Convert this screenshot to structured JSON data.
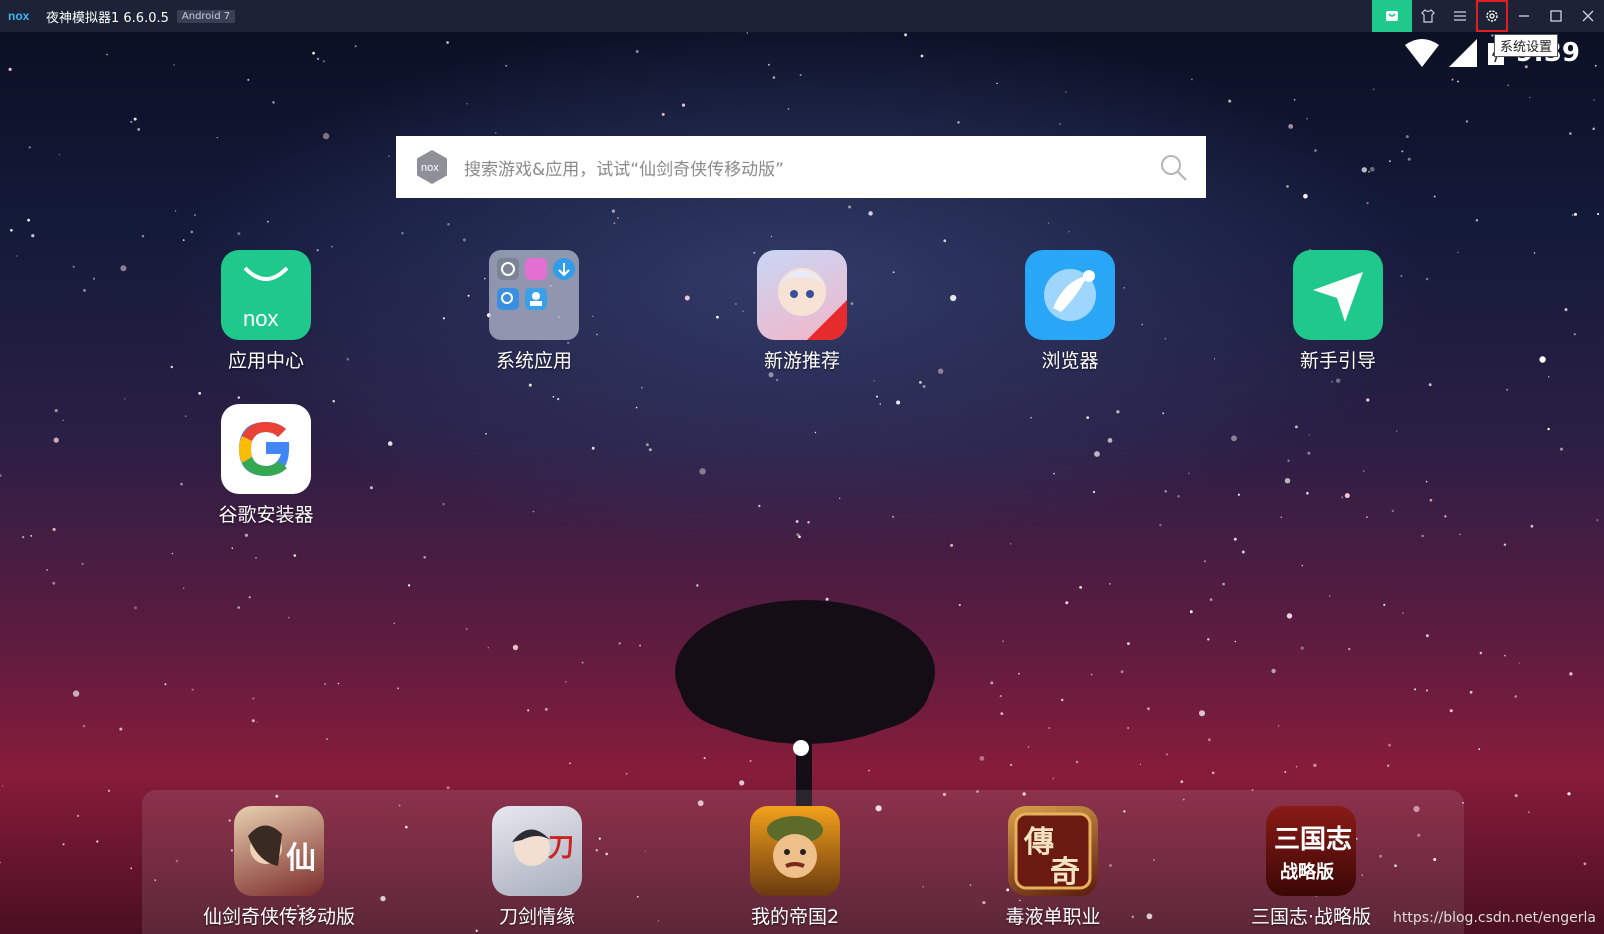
{
  "titlebar": {
    "logo": "nox",
    "title": "夜神模拟器1 6.6.0.5",
    "android_badge": "Android 7",
    "buttons": [
      "store-icon",
      "skin-icon",
      "menu-icon",
      "settings-icon",
      "minimize-icon",
      "maximize-icon",
      "close-icon"
    ],
    "tooltip": "系统设置",
    "accent": "#1ec98b"
  },
  "status": {
    "time": "9:39"
  },
  "search": {
    "placeholder": "搜索游戏&应用，试试“仙剑奇侠传移动版”"
  },
  "apps": [
    {
      "label": "应用中心",
      "icon": "nox-app-center-icon"
    },
    {
      "label": "系统应用",
      "icon": "system-apps-folder-icon"
    },
    {
      "label": "新游推荐",
      "icon": "new-games-icon"
    },
    {
      "label": "浏览器",
      "icon": "browser-icon"
    },
    {
      "label": "新手引导",
      "icon": "guide-icon"
    },
    {
      "label": "谷歌安装器",
      "icon": "google-installer-icon"
    }
  ],
  "dock": [
    {
      "label": "仙剑奇侠传移动版",
      "icon": "xianjian-icon"
    },
    {
      "label": "刀剑情缘",
      "icon": "daojian-icon"
    },
    {
      "label": "我的帝国2",
      "icon": "my-empire-icon"
    },
    {
      "label": "毒液单职业",
      "icon": "chuanqi-icon"
    },
    {
      "label": "三国志·战略版",
      "icon": "sanguozhi-icon"
    }
  ],
  "watermark": "https://blog.csdn.net/engerla"
}
